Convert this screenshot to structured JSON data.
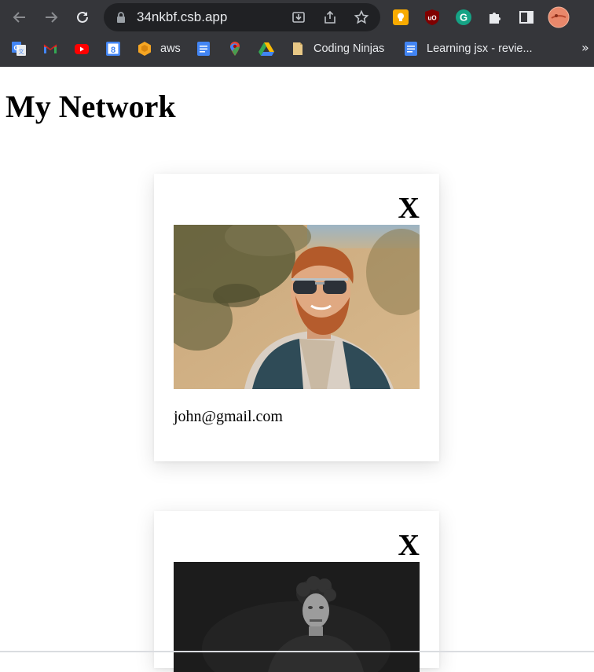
{
  "browser": {
    "url": "34nkbf.csb.app",
    "bookmarks": [
      {
        "label": "",
        "icon": "google-translate-icon"
      },
      {
        "label": "",
        "icon": "gmail-icon"
      },
      {
        "label": "",
        "icon": "youtube-icon"
      },
      {
        "label": "",
        "icon": "google-calendar-icon"
      },
      {
        "label": "aws",
        "icon": "aws-icon"
      },
      {
        "label": "",
        "icon": "google-docs-icon"
      },
      {
        "label": "",
        "icon": "google-maps-icon"
      },
      {
        "label": "",
        "icon": "google-drive-icon"
      },
      {
        "label": "Coding Ninjas",
        "icon": "folder-icon"
      },
      {
        "label": "Learning jsx - revie...",
        "icon": "google-docs-icon"
      }
    ],
    "overflow_label": "»"
  },
  "page": {
    "title": "My Network",
    "cards": [
      {
        "close_label": "X",
        "email": "john@gmail.com",
        "photo": "man-with-sunglasses-photo"
      },
      {
        "close_label": "X",
        "email": "",
        "photo": "man-black-and-white-photo"
      }
    ]
  },
  "colors": {
    "chrome_bg": "#35363a",
    "omnibox_bg": "#202124",
    "chrome_text": "#e8eaed",
    "page_bg": "#ffffff"
  }
}
